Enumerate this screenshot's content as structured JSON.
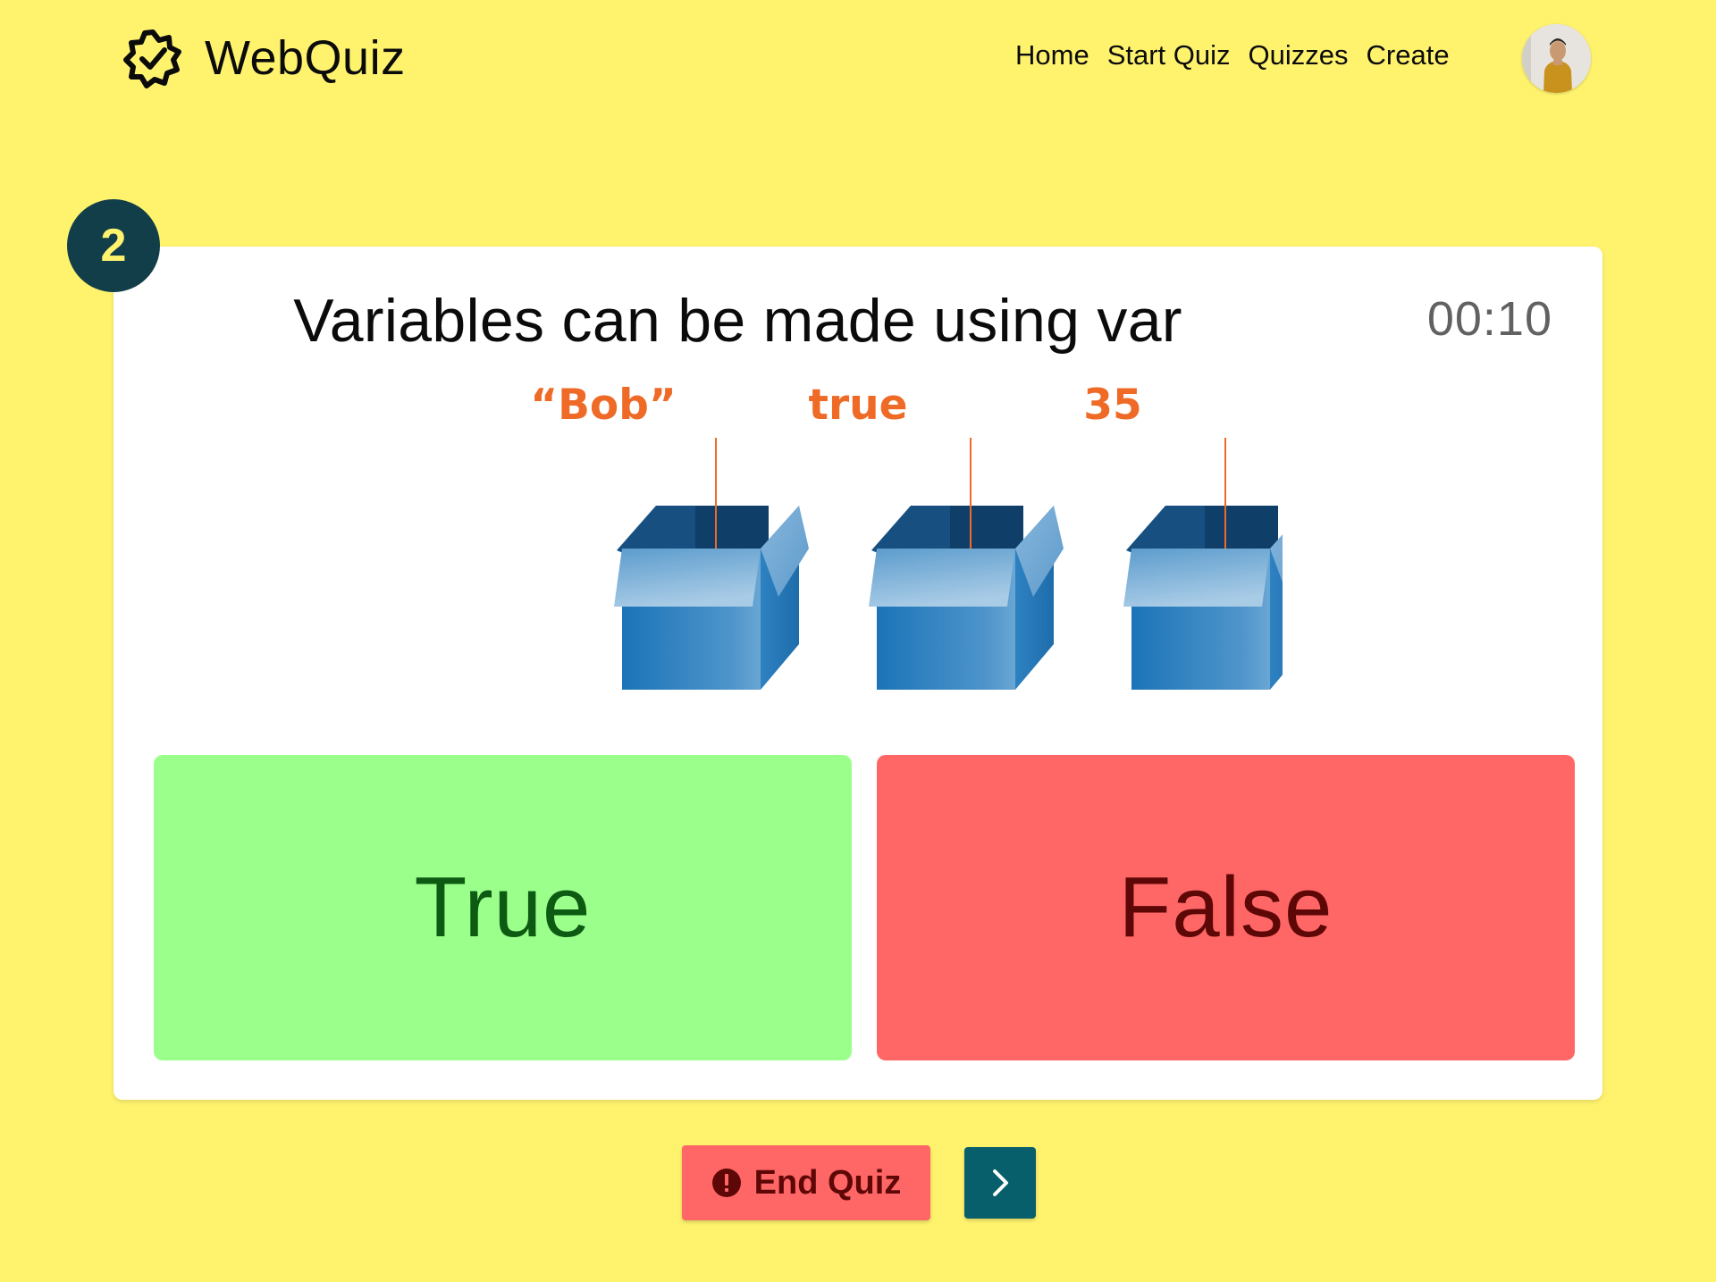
{
  "header": {
    "brand": "WebQuiz",
    "brand_icon": "verified-gear-icon",
    "nav": [
      {
        "label": "Home"
      },
      {
        "label": "Start Quiz"
      },
      {
        "label": "Quizzes"
      },
      {
        "label": "Create"
      }
    ],
    "avatar_icon": "user-avatar"
  },
  "quiz": {
    "question_number": "2",
    "question": "Variables can be made using var",
    "timer": "00:10",
    "illustration": {
      "labels": [
        "“Bob”",
        "true",
        "35"
      ],
      "icon": "open-box-icon"
    },
    "answers": [
      {
        "label": "True",
        "color": "#9bff8b",
        "text_color": "#0d5a12"
      },
      {
        "label": "False",
        "color": "#ff6666",
        "text_color": "#5e0707"
      }
    ]
  },
  "controls": {
    "end_quiz": "End Quiz",
    "end_quiz_icon": "alert-circle-icon",
    "next_icon": "chevron-right-icon"
  },
  "colors": {
    "background": "#fff36e",
    "accent_dark": "#123e4a",
    "next_button": "#065f6b",
    "label_orange": "#ee6a26"
  }
}
